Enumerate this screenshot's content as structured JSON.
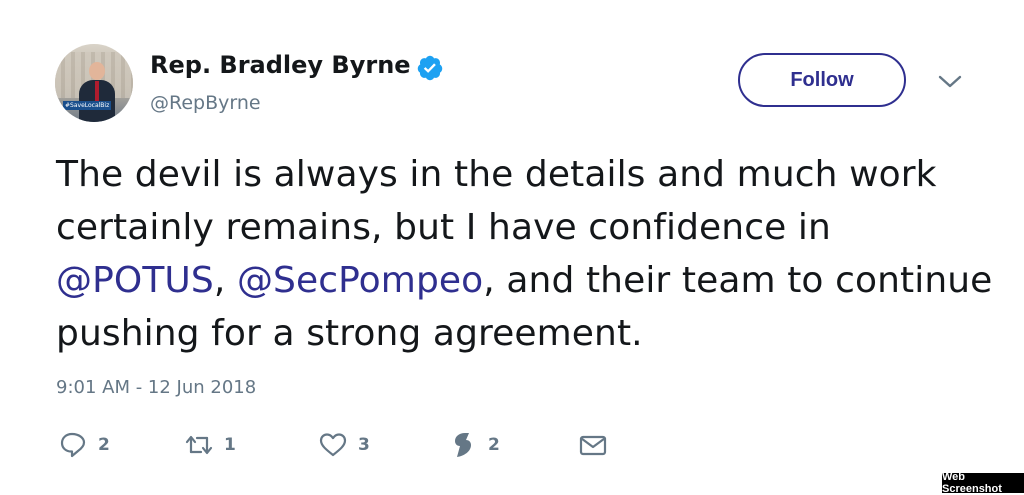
{
  "author": {
    "name": "Rep. Bradley Byrne",
    "handle": "@RepByrne",
    "avatar_badge": "#SaveLocalBiz",
    "verified": true
  },
  "follow_button": {
    "label": "Follow"
  },
  "menu": {
    "icon": "chevron-down-icon"
  },
  "tweet": {
    "text_part1": "The devil is always in the details and much work certainly remains, but I have confidence in ",
    "mention1": "@POTUS",
    "text_part2": ", ",
    "mention2": "@SecPompeo",
    "text_part3": ", and their team to continue pushing for a strong agreement.",
    "timestamp": "9:01 AM - 12 Jun 2018"
  },
  "actions": {
    "replies": "2",
    "retweets": "1",
    "likes": "3",
    "moments": "2"
  },
  "colors": {
    "accent": "#2f2f8f",
    "muted": "#657786",
    "text": "#14171a",
    "verified": "#1da1f2"
  },
  "watermark": "Web Screenshot"
}
